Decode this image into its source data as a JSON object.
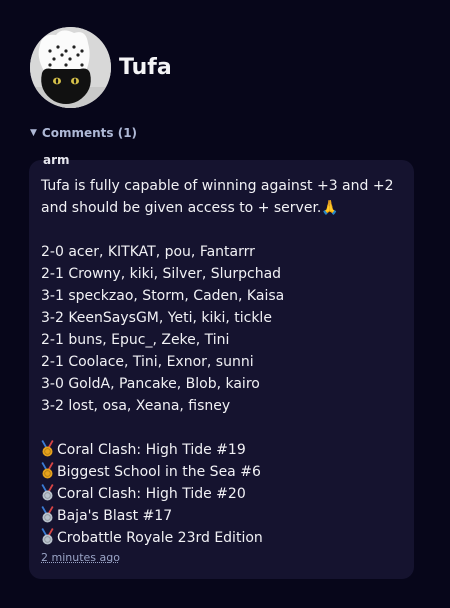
{
  "profile": {
    "name": "Tufa",
    "avatar_icon": "cat-chef-avatar"
  },
  "comments": {
    "toggle_label": "Comments (1)",
    "items": [
      {
        "author": "arm",
        "lines_intro": [
          "Tufa is fully capable of winning against +3 and +2",
          "and should be given access to + server."
        ],
        "intro_emoji": "🙏",
        "results": [
          "2-0 acer, KITKAT, pou, Fantarrr",
          "2-1 Crowny, kiki, Silver, Slurpchad",
          "3-1 speckzao, Storm, Caden, Kaisa",
          "3-2 KeenSaysGM, Yeti, kiki, tickle",
          "2-1 buns, Epuc_, Zeke, Tini",
          "2-1 Coolace, Tini, Exnor, sunni",
          "3-0 GoldA, Pancake, Blob, kairo",
          "3-2 lost, osa, Xeana, fisney"
        ],
        "achievements": [
          {
            "medal": "gold-medal-icon",
            "color": "#e6a21c",
            "text": "Coral Clash: High Tide #19"
          },
          {
            "medal": "gold-medal-icon",
            "color": "#e6a21c",
            "text": "Biggest School in the Sea #6"
          },
          {
            "medal": "silver-medal-icon",
            "color": "#b9c2cc",
            "text": "Coral Clash: High Tide #20"
          },
          {
            "medal": "silver-medal-icon",
            "color": "#b9c2cc",
            "text": "Baja's Blast #17"
          },
          {
            "medal": "silver-medal-icon",
            "color": "#b9c2cc",
            "text": "Crobattle Royale 23rd Edition"
          }
        ],
        "timestamp": "2 minutes ago"
      }
    ]
  },
  "colors": {
    "background": "#07061a",
    "card": "#15132f",
    "muted_text": "#aeb8d6"
  }
}
